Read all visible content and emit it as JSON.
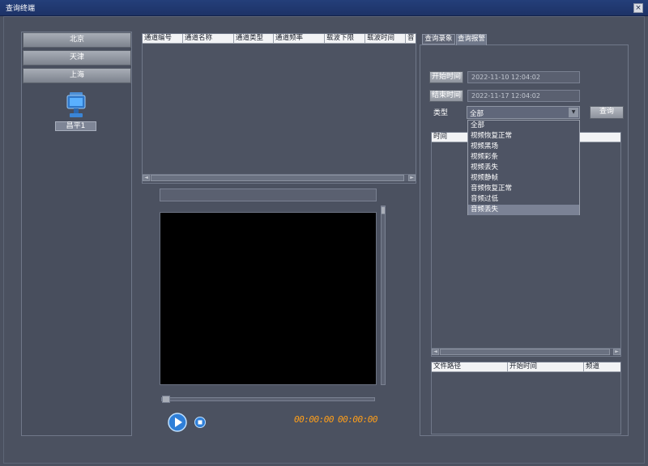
{
  "window": {
    "title": "查询终端",
    "close": "×"
  },
  "regions": [
    "北京",
    "天津",
    "上海"
  ],
  "device": {
    "label": "昌平1",
    "icon": "monitor-icon"
  },
  "channel_table": {
    "columns": [
      "通道编号",
      "通道名称",
      "通道类型",
      "通道频率",
      "载波下限",
      "载波时间",
      "音"
    ]
  },
  "scroll": {
    "left": "◄",
    "right": "►",
    "mid": "Ⅲ",
    "up": "▲",
    "down": "▼"
  },
  "player": {
    "time_current": "00:00:00",
    "time_total": "00:00:00",
    "play_icon": "play-icon",
    "stop_icon": "stop-icon"
  },
  "tabs": [
    "查询录象",
    "查询报警"
  ],
  "query": {
    "start_label": "开始时间",
    "start_value": "2022-11-10 12:04:02",
    "end_label": "结束时间",
    "end_value": "2022-11-17 12:04:02",
    "type_label": "类型",
    "type_selected": "全部",
    "type_options": [
      "全部",
      "视频恢复正常",
      "视频黑场",
      "视频彩条",
      "视频丢失",
      "视频静帧",
      "音频恢复正常",
      "音频过低",
      "音频丢失"
    ],
    "type_highlight": 8,
    "search_label": "查询"
  },
  "alarm_table": {
    "columns": [
      "时间",
      ""
    ]
  },
  "file_table": {
    "columns": [
      "文件路径",
      "开始时间",
      "频道"
    ]
  },
  "colors": {
    "accent_time": "#ff9f1a",
    "titlebar": "#243f7a"
  }
}
